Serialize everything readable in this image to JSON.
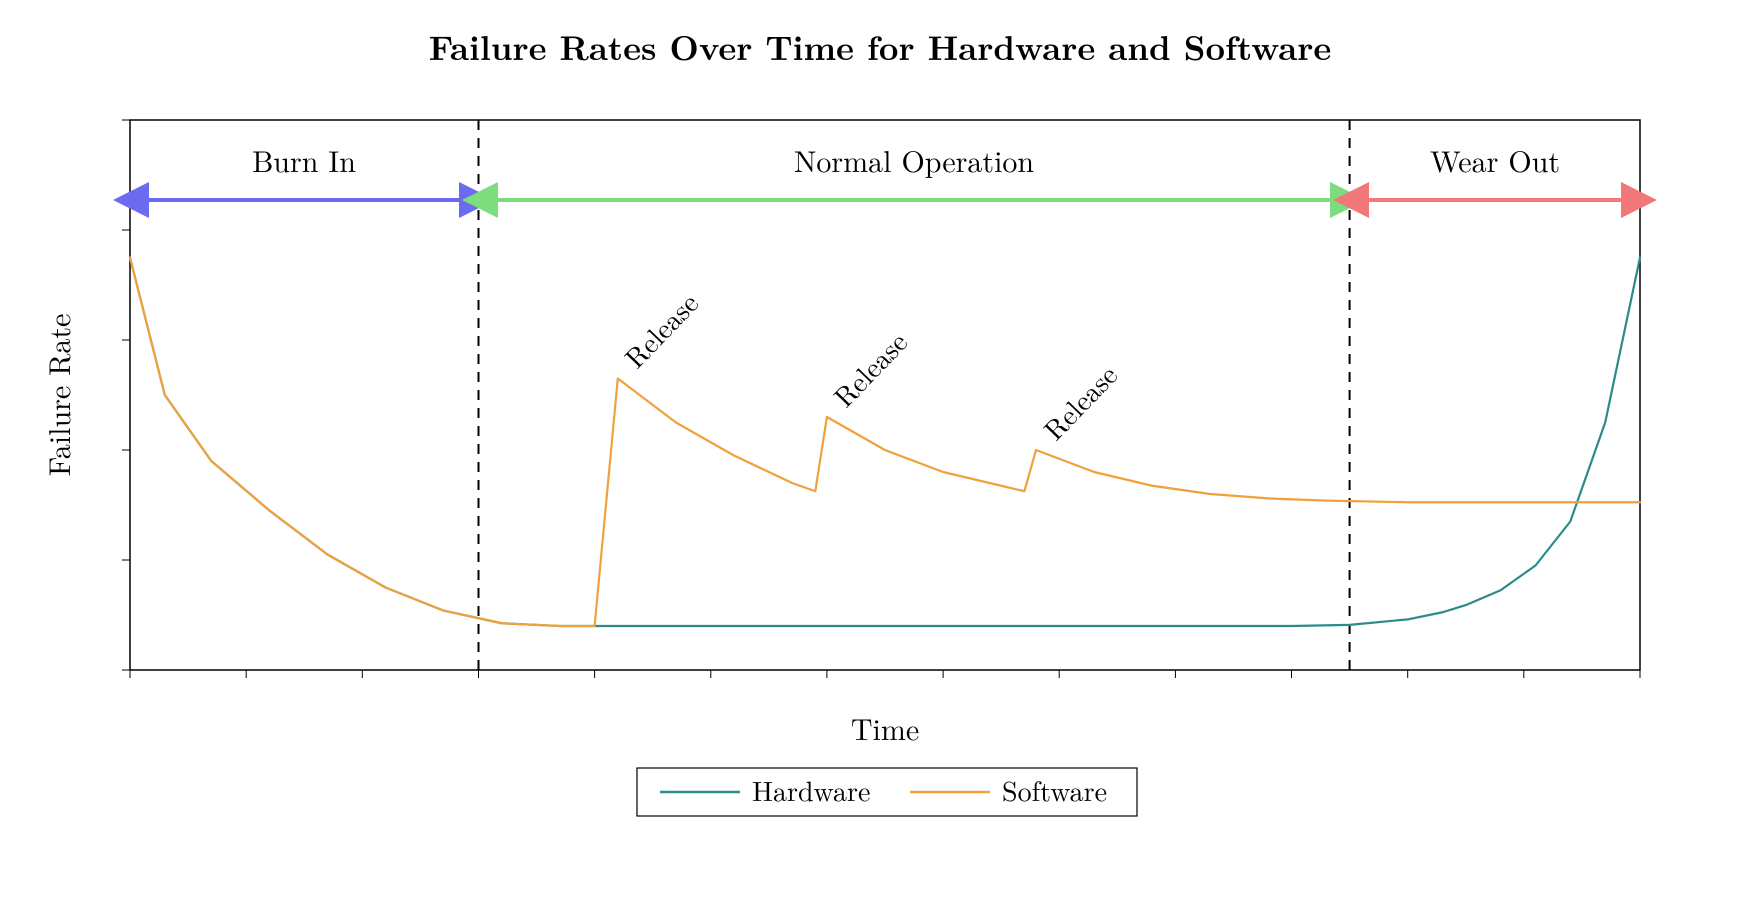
{
  "chart_data": {
    "type": "line",
    "title": "Failure Rates Over Time for Hardware and Software",
    "xlabel": "Time",
    "ylabel": "Failure Rate",
    "xlim": [
      0,
      13
    ],
    "ylim": [
      0,
      10
    ],
    "phases": [
      {
        "name": "Burn In",
        "x0": 0,
        "x1": 3,
        "color": "#6b6bf0"
      },
      {
        "name": "Normal Operation",
        "x0": 3,
        "x1": 10.5,
        "color": "#7ddc7d"
      },
      {
        "name": "Wear Out",
        "x0": 10.5,
        "x1": 13,
        "color": "#f07878"
      }
    ],
    "release_markers": [
      {
        "label": "Release",
        "x": 4.2
      },
      {
        "label": "Release",
        "x": 6.0
      },
      {
        "label": "Release",
        "x": 7.8
      }
    ],
    "series": [
      {
        "name": "Hardware",
        "color": "#2b8a8a",
        "points": [
          [
            0,
            7.5
          ],
          [
            0.3,
            5.0
          ],
          [
            0.7,
            3.8
          ],
          [
            1.2,
            2.9
          ],
          [
            1.7,
            2.1
          ],
          [
            2.2,
            1.5
          ],
          [
            2.7,
            1.08
          ],
          [
            3.2,
            0.85
          ],
          [
            3.7,
            0.8
          ],
          [
            4.2,
            0.8
          ],
          [
            5,
            0.8
          ],
          [
            6,
            0.8
          ],
          [
            7,
            0.8
          ],
          [
            8,
            0.8
          ],
          [
            9,
            0.8
          ],
          [
            10,
            0.8
          ],
          [
            10.5,
            0.82
          ],
          [
            11,
            0.92
          ],
          [
            11.3,
            1.05
          ],
          [
            11.5,
            1.18
          ],
          [
            11.8,
            1.45
          ],
          [
            12.1,
            1.9
          ],
          [
            12.4,
            2.7
          ],
          [
            12.7,
            4.5
          ],
          [
            12.85,
            6.0
          ],
          [
            13,
            7.5
          ]
        ]
      },
      {
        "name": "Software",
        "color": "#f0a03c",
        "points": [
          [
            0,
            7.5
          ],
          [
            0.3,
            5.0
          ],
          [
            0.7,
            3.8
          ],
          [
            1.2,
            2.9
          ],
          [
            1.7,
            2.1
          ],
          [
            2.2,
            1.5
          ],
          [
            2.7,
            1.08
          ],
          [
            3.2,
            0.85
          ],
          [
            3.7,
            0.8
          ],
          [
            4.0,
            0.8
          ],
          [
            4.2,
            5.3
          ],
          [
            4.7,
            4.5
          ],
          [
            5.2,
            3.9
          ],
          [
            5.7,
            3.4
          ],
          [
            5.9,
            3.25
          ],
          [
            6.0,
            4.6
          ],
          [
            6.5,
            4.0
          ],
          [
            7.0,
            3.6
          ],
          [
            7.5,
            3.35
          ],
          [
            7.7,
            3.25
          ],
          [
            7.8,
            4.0
          ],
          [
            8.3,
            3.6
          ],
          [
            8.8,
            3.35
          ],
          [
            9.3,
            3.2
          ],
          [
            9.8,
            3.12
          ],
          [
            10.3,
            3.08
          ],
          [
            11,
            3.05
          ],
          [
            12,
            3.05
          ],
          [
            13,
            3.05
          ]
        ]
      }
    ]
  },
  "legend": {
    "hardware": "Hardware",
    "software": "Software"
  },
  "labels": {
    "title": "Failure Rates Over Time for Hardware and Software",
    "xlabel": "Time",
    "ylabel": "Failure Rate",
    "burn_in": "Burn In",
    "normal": "Normal Operation",
    "wear_out": "Wear Out",
    "release1": "Release",
    "release2": "Release",
    "release3": "Release"
  },
  "colors": {
    "hardware": "#2b8a8a",
    "software": "#f0a03c",
    "burn_in": "#6b6bf0",
    "normal": "#7ddc7d",
    "wear_out": "#f07878",
    "axis": "#000000"
  }
}
